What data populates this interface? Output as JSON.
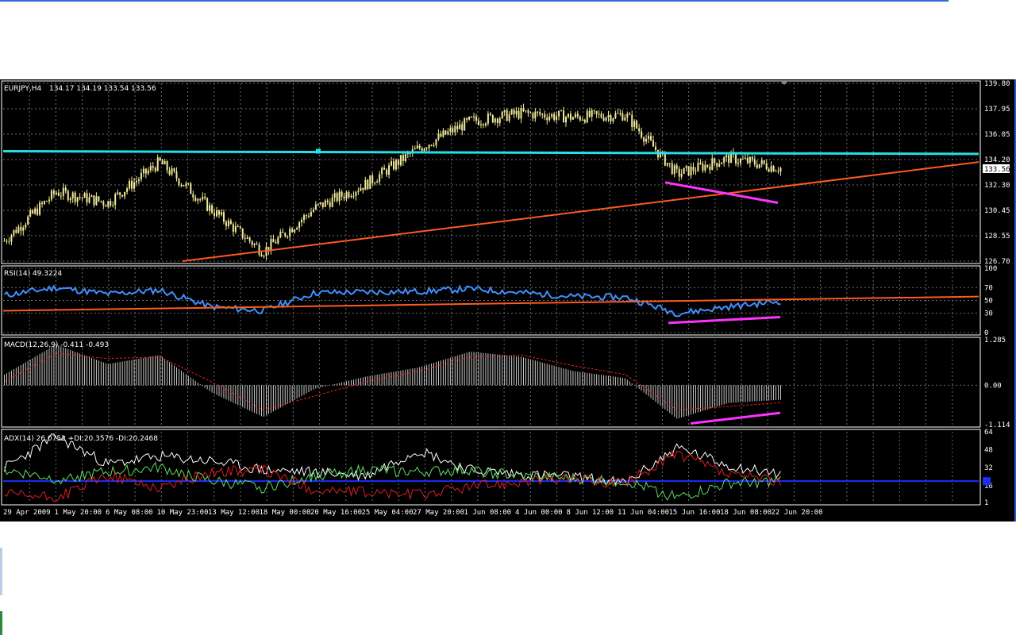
{
  "main_chart": {
    "symbol_label": "EURJPY,H4",
    "ohlc_text": "134.17 134.19 133.54 133.56",
    "price_axis": [
      "139.80",
      "137.95",
      "136.05",
      "134.20",
      "132.30",
      "130.45",
      "128.55",
      "126.70"
    ],
    "current_price": "133.56",
    "colors": {
      "candles": "#f2ea9a",
      "support_line": "#ff5a1f",
      "resistance_line": "#22e0e8",
      "divergence_line": "#ff33ff",
      "grid": "#6b6b6b"
    }
  },
  "rsi": {
    "header": "RSI(14) 49.3224",
    "axis": [
      "100",
      "70",
      "50",
      "30",
      "0"
    ],
    "line_color": "#3f8fff"
  },
  "macd": {
    "header": "MACD(12,26,9) -0.411 -0.493",
    "axis": [
      "1.285",
      "0.00",
      "-1.114"
    ],
    "histogram_color": "#c8c8c8",
    "signal_color": "#e02020"
  },
  "adx": {
    "header": "ADX(14) 26.0752 +DI:20.3576 -DI:20.2468",
    "axis": [
      "64",
      "48",
      "32",
      "16",
      "1"
    ],
    "adx_color": "#ffffff",
    "plus_di_color": "#5fe05f",
    "minus_di_color": "#e01e1e",
    "level_color": "#1c2cff"
  },
  "time_axis": [
    "29 Apr 2009",
    "1 May 20:00",
    "6 May 08:00",
    "10 May 23:00",
    "13 May 12:00",
    "18 May 00:00",
    "20 May 16:00",
    "25 May 04:00",
    "27 May 20:00",
    "1 Jun 08:00",
    "4 Jun 00:00",
    "8 Jun 12:00",
    "11 Jun 04:00",
    "15 Jun 16:00",
    "18 Jun 08:00",
    "22 Jun 20:00"
  ],
  "chart_data": [
    {
      "type": "candlestick",
      "title": "EURJPY,H4",
      "ylim": [
        126.7,
        139.8
      ],
      "x": [
        "29 Apr 2009",
        "1 May 20:00",
        "6 May 08:00",
        "10 May 23:00",
        "13 May 12:00",
        "18 May 00:00",
        "20 May 16:00",
        "25 May 04:00",
        "27 May 20:00",
        "1 Jun 08:00",
        "4 Jun 00:00",
        "8 Jun 12:00",
        "11 Jun 04:00",
        "15 Jun 16:00",
        "18 Jun 08:00",
        "22 Jun 20:00"
      ],
      "close": [
        128.2,
        131.8,
        131.0,
        134.0,
        130.5,
        127.4,
        130.6,
        132.4,
        135.0,
        137.0,
        137.6,
        137.3,
        137.5,
        133.1,
        134.3,
        133.56
      ]
    },
    {
      "type": "line",
      "title": "RSI(14) 49.3224",
      "ylim": [
        0,
        100
      ],
      "x": [
        "29 Apr 2009",
        "1 May 20:00",
        "6 May 08:00",
        "10 May 23:00",
        "13 May 12:00",
        "18 May 00:00",
        "20 May 16:00",
        "25 May 04:00",
        "27 May 20:00",
        "1 Jun 08:00",
        "4 Jun 00:00",
        "8 Jun 12:00",
        "11 Jun 04:00",
        "15 Jun 16:00",
        "18 Jun 08:00",
        "22 Jun 20:00"
      ],
      "values": [
        58,
        70,
        60,
        66,
        40,
        34,
        62,
        63,
        64,
        68,
        62,
        56,
        55,
        30,
        40,
        49
      ]
    },
    {
      "type": "bar",
      "title": "MACD(12,26,9) -0.411 -0.493",
      "ylim": [
        -1.114,
        1.285
      ],
      "x": [
        "29 Apr 2009",
        "1 May 20:00",
        "6 May 08:00",
        "10 May 23:00",
        "13 May 12:00",
        "18 May 00:00",
        "20 May 16:00",
        "25 May 04:00",
        "27 May 20:00",
        "1 Jun 08:00",
        "4 Jun 00:00",
        "8 Jun 12:00",
        "11 Jun 04:00",
        "15 Jun 16:00",
        "18 Jun 08:00",
        "22 Jun 20:00"
      ],
      "values": [
        0.3,
        1.15,
        0.6,
        0.85,
        -0.2,
        -0.9,
        -0.1,
        0.25,
        0.5,
        0.95,
        0.8,
        0.4,
        0.2,
        -0.95,
        -0.5,
        -0.41
      ],
      "signal": [
        0.1,
        0.9,
        0.75,
        0.8,
        0.1,
        -0.7,
        -0.3,
        0.1,
        0.4,
        0.8,
        0.85,
        0.55,
        0.3,
        -0.7,
        -0.6,
        -0.49
      ]
    },
    {
      "type": "line",
      "title": "ADX(14) 26.0752 +DI:20.3576 -DI:20.2468",
      "ylim": [
        1,
        64
      ],
      "x": [
        "29 Apr 2009",
        "1 May 20:00",
        "6 May 08:00",
        "10 May 23:00",
        "13 May 12:00",
        "18 May 00:00",
        "20 May 16:00",
        "25 May 04:00",
        "27 May 20:00",
        "1 Jun 08:00",
        "4 Jun 00:00",
        "8 Jun 12:00",
        "11 Jun 04:00",
        "15 Jun 16:00",
        "18 Jun 08:00",
        "22 Jun 20:00"
      ],
      "series": [
        {
          "name": "ADX(14)",
          "values": [
            32,
            60,
            35,
            42,
            38,
            30,
            28,
            25,
            48,
            30,
            26,
            24,
            18,
            50,
            34,
            26
          ]
        },
        {
          "name": "+DI",
          "values": [
            30,
            22,
            28,
            32,
            20,
            14,
            25,
            30,
            28,
            30,
            24,
            22,
            20,
            5,
            18,
            20
          ]
        },
        {
          "name": "-DI",
          "values": [
            8,
            5,
            25,
            14,
            28,
            30,
            12,
            10,
            8,
            15,
            20,
            22,
            18,
            45,
            25,
            20
          ]
        }
      ]
    }
  ]
}
